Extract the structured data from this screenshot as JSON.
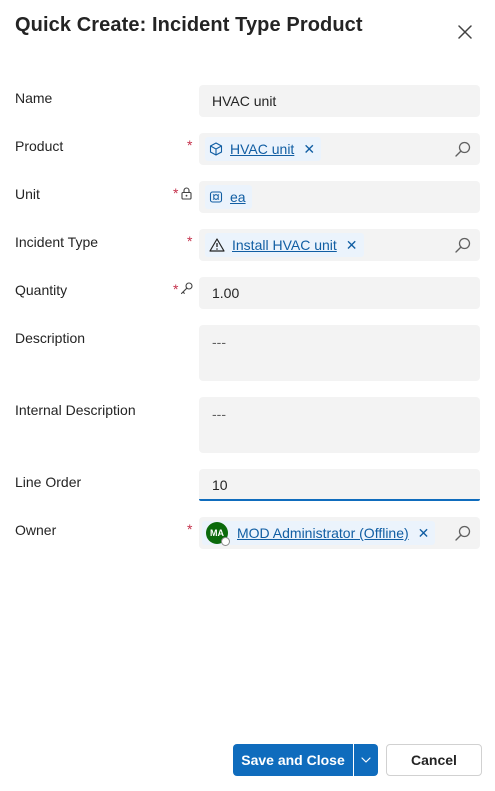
{
  "dialog": {
    "title": "Quick Create: Incident Type Product"
  },
  "fields": {
    "name": {
      "label": "Name",
      "value": "HVAC unit"
    },
    "product": {
      "label": "Product",
      "required": "*",
      "value": "HVAC unit",
      "remove": "✕"
    },
    "unit": {
      "label": "Unit",
      "required": "*",
      "value": "ea"
    },
    "incident_type": {
      "label": "Incident Type",
      "required": "*",
      "value": "Install HVAC unit",
      "remove": "✕"
    },
    "quantity": {
      "label": "Quantity",
      "required": "*",
      "value": "1.00"
    },
    "description": {
      "label": "Description",
      "value": "---"
    },
    "internal_description": {
      "label": "Internal Description",
      "value": "---"
    },
    "line_order": {
      "label": "Line Order",
      "value": "10"
    },
    "owner": {
      "label": "Owner",
      "required": "*",
      "initials": "MA",
      "value": "MOD Administrator (Offline)",
      "remove": "✕"
    }
  },
  "footer": {
    "save_label": "Save and Close",
    "cancel_label": "Cancel"
  },
  "colors": {
    "accent": "#0f6cbd",
    "required": "#c4314b",
    "avatar": "#0b6a0b"
  }
}
